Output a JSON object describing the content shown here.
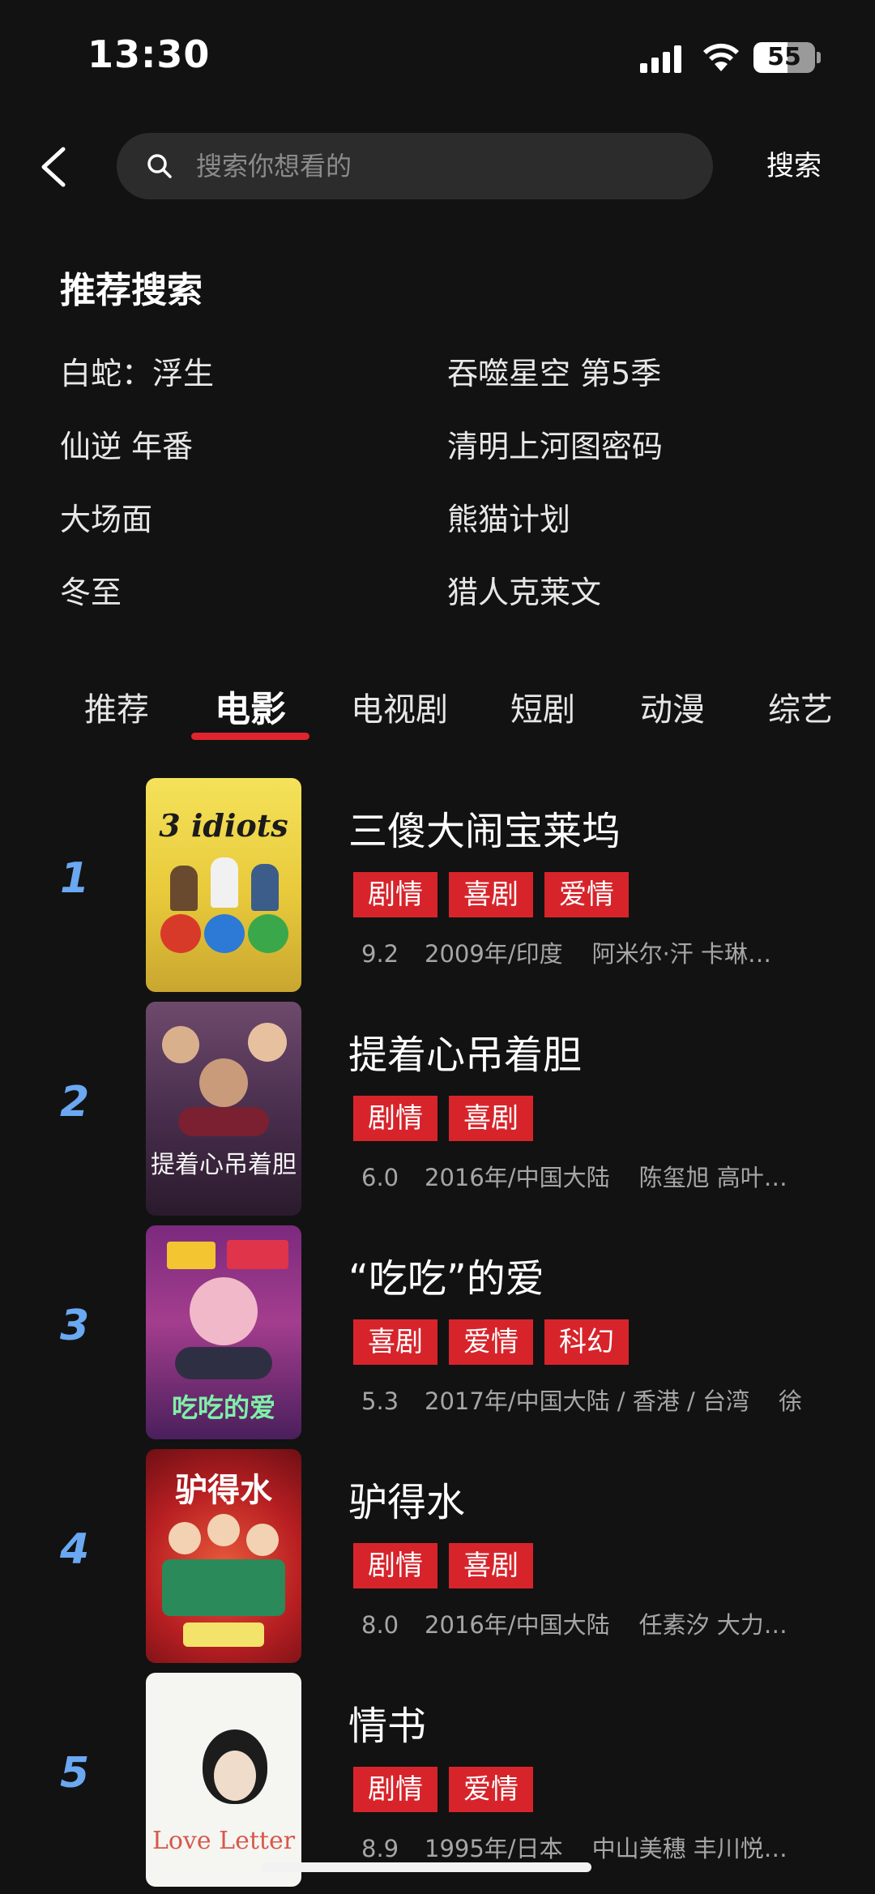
{
  "status_bar": {
    "time": "13:30",
    "battery_level": "55",
    "battery_fraction": 0.55
  },
  "search": {
    "placeholder": "搜索你想看的",
    "submit_label": "搜索"
  },
  "recommended": {
    "title": "推荐搜索",
    "items": [
      "白蛇：浮生",
      "吞噬星空 第5季",
      "仙逆 年番",
      "清明上河图密码",
      "大场面",
      "熊猫计划",
      "冬至",
      "猎人克莱文"
    ]
  },
  "tabs": [
    "推荐",
    "电影",
    "电视剧",
    "短剧",
    "动漫",
    "综艺"
  ],
  "active_tab": "电影",
  "colors": {
    "accent": "#e0242e",
    "tag_bg": "#d7242b",
    "rank": "#6aa8f2",
    "background": "#121212"
  },
  "movies": [
    {
      "rank": "1",
      "title": "三傻大闹宝莱坞",
      "tags": [
        "剧情",
        "喜剧",
        "爱情"
      ],
      "score": "9.2",
      "year": "2009年/印度",
      "cast": "阿米尔·汗 卡琳…",
      "poster_text": "3 idiots"
    },
    {
      "rank": "2",
      "title": "提着心吊着胆",
      "tags": [
        "剧情",
        "喜剧"
      ],
      "score": "6.0",
      "year": "2016年/中国大陆",
      "cast": "陈玺旭 高叶…",
      "poster_text": "提着心吊着胆"
    },
    {
      "rank": "3",
      "title": "“吃吃”的爱",
      "tags": [
        "喜剧",
        "爱情",
        "科幻"
      ],
      "score": "5.3",
      "year": "2017年/中国大陆 / 香港 / 台湾",
      "cast": "徐",
      "poster_text": "吃吃的爱"
    },
    {
      "rank": "4",
      "title": "驴得水",
      "tags": [
        "剧情",
        "喜剧"
      ],
      "score": "8.0",
      "year": "2016年/中国大陆",
      "cast": "任素汐 大力…",
      "poster_text": "驴得水"
    },
    {
      "rank": "5",
      "title": "情书",
      "tags": [
        "剧情",
        "爱情"
      ],
      "score": "8.9",
      "year": "1995年/日本",
      "cast": "中山美穗 丰川悦…",
      "poster_text": "Love Letter"
    }
  ]
}
